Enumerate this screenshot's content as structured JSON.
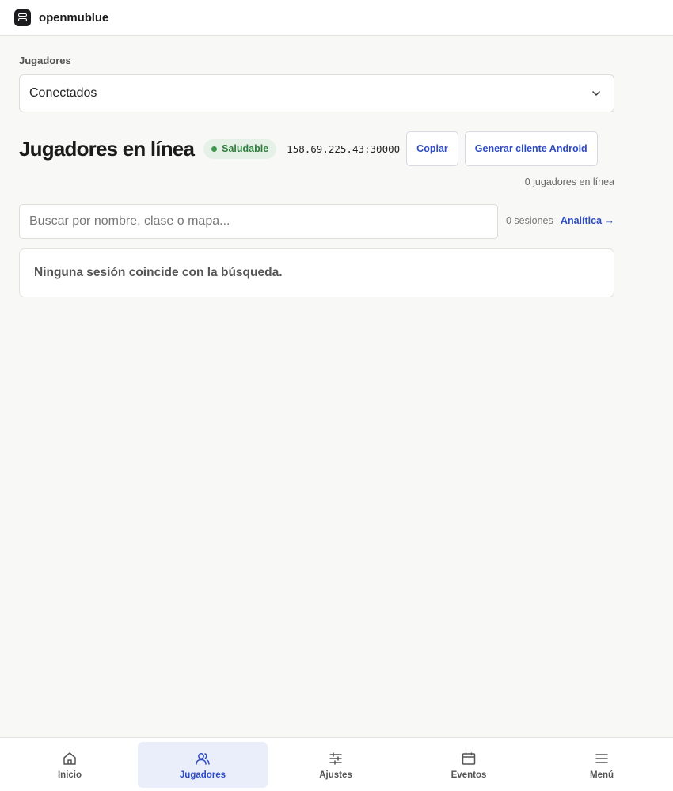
{
  "app": {
    "name": "openmublue"
  },
  "filter": {
    "label": "Jugadores",
    "selected": "Conectados"
  },
  "header": {
    "title": "Jugadores en línea",
    "status": "Saludable",
    "server_address": "158.69.225.43:30000",
    "copy_label": "Copiar",
    "android_label": "Generar cliente Android"
  },
  "stats": {
    "online_count": "0 jugadores en línea",
    "sessions": "0 sesiones"
  },
  "search": {
    "placeholder": "Buscar por nombre, clase o mapa..."
  },
  "links": {
    "analytics": "Analítica →"
  },
  "empty_state": {
    "message": "Ninguna sesión coincide con la búsqueda."
  },
  "nav": [
    {
      "label": "Inicio",
      "icon": "home-icon",
      "active": false
    },
    {
      "label": "Jugadores",
      "icon": "users-icon",
      "active": true
    },
    {
      "label": "Ajustes",
      "icon": "sliders-icon",
      "active": false
    },
    {
      "label": "Eventos",
      "icon": "calendar-icon",
      "active": false
    },
    {
      "label": "Menú",
      "icon": "menu-icon",
      "active": false
    }
  ],
  "colors": {
    "accent": "#2d4cc4",
    "healthy": "#2f7d3d",
    "background": "#f8f8f6"
  }
}
